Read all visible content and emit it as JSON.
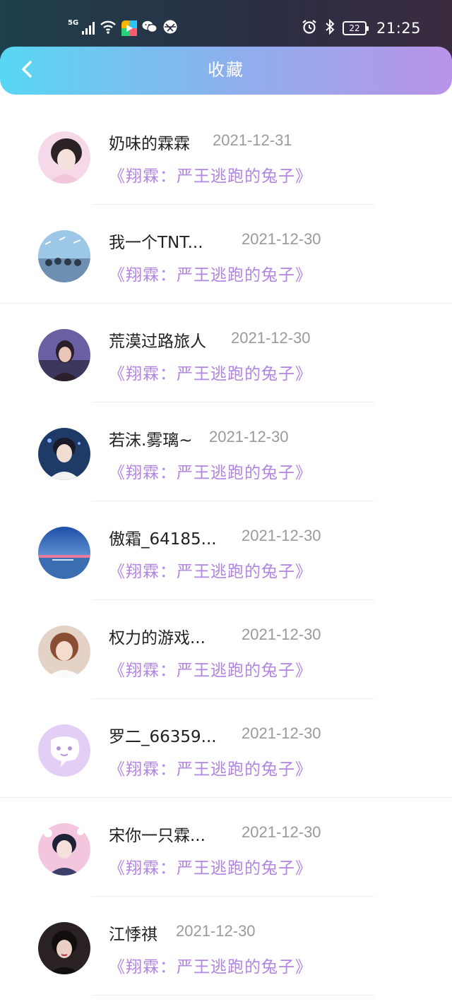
{
  "status_bar": {
    "network": "5G",
    "battery": "22",
    "time": "21:25",
    "icons": [
      "signal-icon",
      "wifi-icon",
      "app-icon",
      "wechat-icon",
      "browser-icon",
      "alarm-icon",
      "bluetooth-icon",
      "battery-icon"
    ]
  },
  "header": {
    "title": "收藏",
    "back_icon": "chevron-left-icon",
    "gradient": [
      "#57d7f3",
      "#b993ea"
    ]
  },
  "colors": {
    "book_title": "#b285e2",
    "date": "#9a9a9a",
    "name": "#222222"
  },
  "favorites": [
    {
      "name": "奶味的霖霖",
      "date": "2021-12-31",
      "book": "《翔霖：严王逃跑的兔子》"
    },
    {
      "name": "我一个TNT...",
      "date": "2021-12-30",
      "book": "《翔霖：严王逃跑的兔子》"
    },
    {
      "name": "荒漠过路旅人",
      "date": "2021-12-30",
      "book": "《翔霖：严王逃跑的兔子》"
    },
    {
      "name": "若沫.雾璃~",
      "date": "2021-12-30",
      "book": "《翔霖：严王逃跑的兔子》"
    },
    {
      "name": "傲霜_64185...",
      "date": "2021-12-30",
      "book": "《翔霖：严王逃跑的兔子》"
    },
    {
      "name": "权力的游戏...",
      "date": "2021-12-30",
      "book": "《翔霖：严王逃跑的兔子》"
    },
    {
      "name": "罗二_66359...",
      "date": "2021-12-30",
      "book": "《翔霖：严王逃跑的兔子》"
    },
    {
      "name": "宋你一只霖...",
      "date": "2021-12-30",
      "book": "《翔霖：严王逃跑的兔子》"
    },
    {
      "name": "江悸祺",
      "date": "2021-12-30",
      "book": "《翔霖：严王逃跑的兔子》"
    }
  ]
}
